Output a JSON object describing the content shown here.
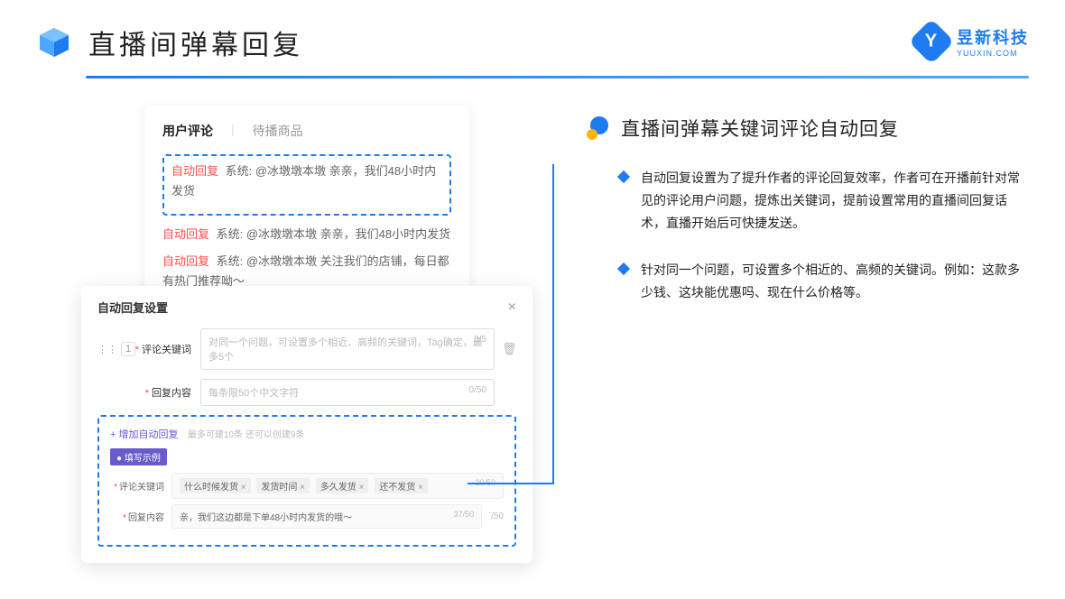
{
  "header": {
    "title": "直播间弹幕回复"
  },
  "logo": {
    "name": "昱新科技",
    "sub": "YUUXIN.COM",
    "letter": "Y"
  },
  "tabs": {
    "active": "用户评论",
    "inactive": "待播商品"
  },
  "comments": {
    "highlighted": {
      "tag": "自动回复",
      "text": "系统: @冰墩墩本墩 亲亲，我们48小时内发货"
    },
    "row2": {
      "tag": "自动回复",
      "text": "系统: @冰墩墩本墩 亲亲，我们48小时内发货"
    },
    "row3": {
      "tag": "自动回复",
      "text": "系统: @冰墩墩本墩 关注我们的店铺，每日都有热门推荐呦～"
    }
  },
  "settings": {
    "title": "自动回复设置",
    "index": "1",
    "keyword_label": "评论关键词",
    "keyword_placeholder": "对同一个问题，可设置多个相近、高频的关键词，Tag确定，最多5个",
    "keyword_count": "0/5",
    "content_label": "回复内容",
    "content_placeholder": "每条限50个中文字符",
    "content_count": "0/50",
    "add_link": "+ 增加自动回复",
    "add_hint": "最多可建10条 还可以创建9条",
    "example_badge": "● 填写示例",
    "ex_keyword_label": "评论关键词",
    "ex_tags": [
      "什么时候发货",
      "发货时间",
      "多久发货",
      "还不发货"
    ],
    "ex_keyword_count": "20/50",
    "ex_content_label": "回复内容",
    "ex_content_value": "亲，我们这边都是下单48小时内发货的哦～",
    "ex_content_count": "37/50",
    "side_count": "/50"
  },
  "right": {
    "section_title": "直播间弹幕关键词评论自动回复",
    "bullet1": "自动回复设置为了提升作者的评论回复效率，作者可在开播前针对常见的评论用户问题，提炼出关键词，提前设置常用的直播间回复话术，直播开始后可快捷发送。",
    "bullet2": "针对同一个问题，可设置多个相近的、高频的关键词。例如：这款多少钱、这块能优惠吗、现在什么价格等。"
  }
}
